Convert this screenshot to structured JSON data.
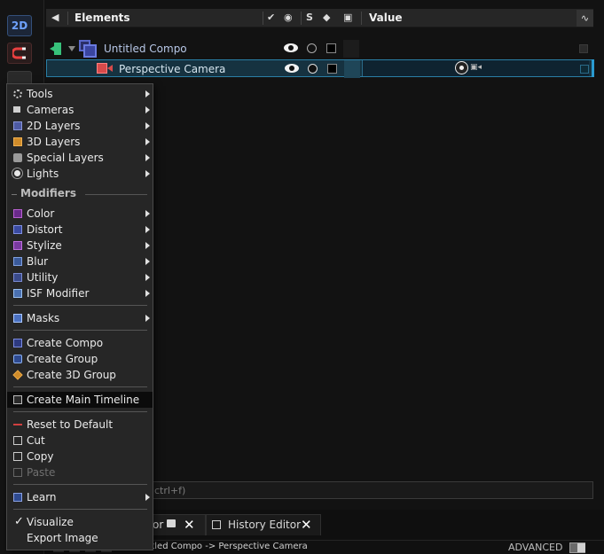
{
  "toolbar": {
    "mode_2d": "2D"
  },
  "elements": {
    "header": {
      "title": "Elements",
      "col_s": "S",
      "col_value": "Value"
    },
    "rows": [
      {
        "name": "Untitled Compo"
      },
      {
        "name": "Perspective Camera"
      }
    ],
    "search_hint": "ctrl+f)"
  },
  "menu": {
    "tools": "Tools",
    "cameras": "Cameras",
    "layers_2d": "2D Layers",
    "layers_3d": "3D Layers",
    "special_layers": "Special Layers",
    "lights": "Lights",
    "modifiers_header": "Modifiers",
    "color": "Color",
    "distort": "Distort",
    "stylize": "Stylize",
    "blur": "Blur",
    "utility": "Utility",
    "isf_modifier": "ISF Modifier",
    "masks": "Masks",
    "create_compo": "Create Compo",
    "create_group": "Create Group",
    "create_3d_group": "Create 3D Group",
    "create_main_timeline": "Create Main Timeline",
    "reset_to_default": "Reset to Default",
    "cut": "Cut",
    "copy": "Copy",
    "paste": "Paste",
    "learn": "Learn",
    "visualize": "Visualize",
    "export_image": "Export Image"
  },
  "bottom": {
    "tab_left_label": "or",
    "tab_history": "History Editor",
    "close_glyph": "✕",
    "path": "Untitled Compo -> Perspective Camera",
    "advanced": "ADVANCED"
  },
  "colors": {
    "selection_row": "#163240",
    "selection_border": "#2a7fa6",
    "compo_flag": "#37c17a",
    "camera_icon": "#d84a4a"
  }
}
